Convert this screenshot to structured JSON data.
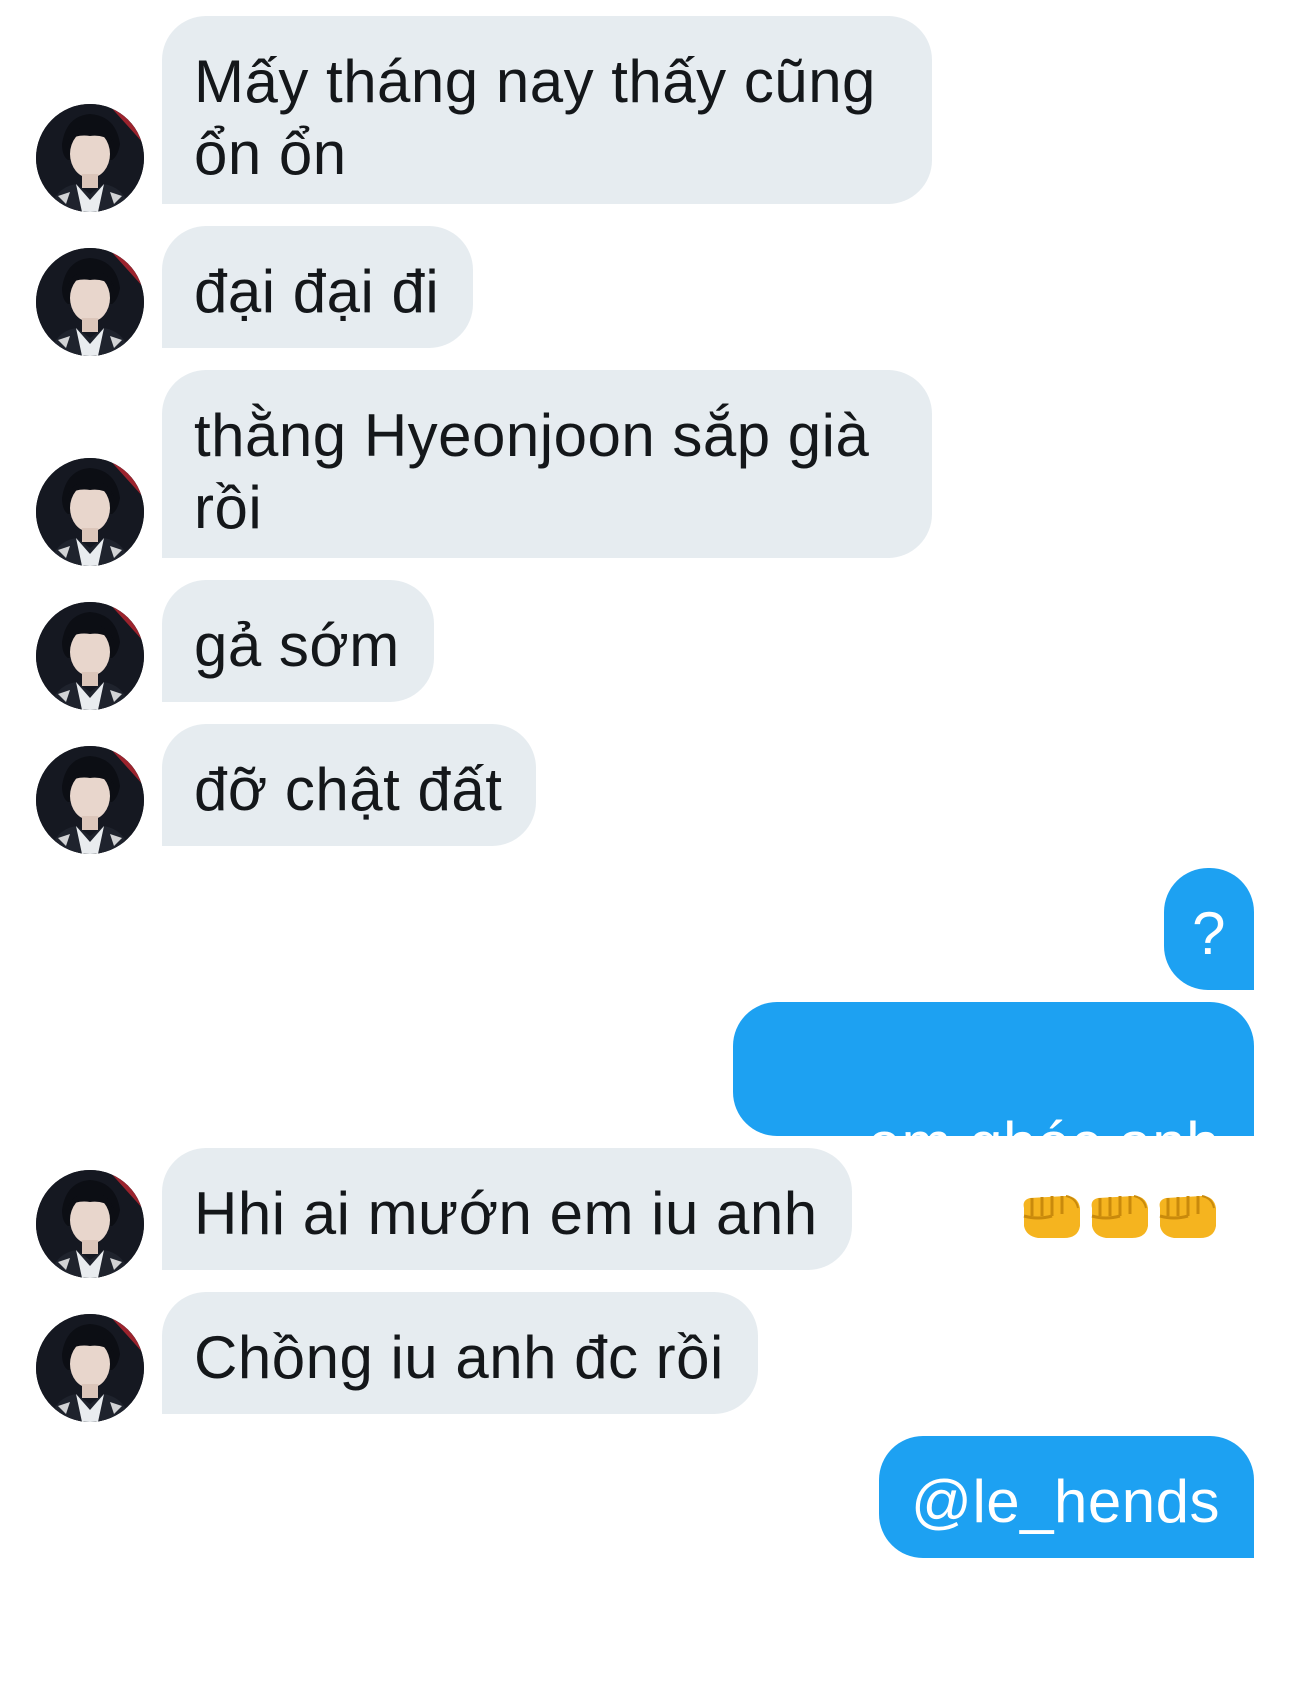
{
  "conversation": {
    "messages": [
      {
        "sender": "them",
        "text": "Mấy tháng nay thấy cũng ổn ổn"
      },
      {
        "sender": "them",
        "text": "đại đại đi"
      },
      {
        "sender": "them",
        "text": "thằng Hyeonjoon sắp già rồi"
      },
      {
        "sender": "them",
        "text": "gả sớm"
      },
      {
        "sender": "them",
        "text": "đỡ chật đất"
      },
      {
        "sender": "me",
        "text": "?"
      },
      {
        "sender": "me",
        "text": "em ghéc anh",
        "emoji": [
          "oncoming-fist-icon",
          "oncoming-fist-icon",
          "oncoming-fist-icon"
        ]
      },
      {
        "sender": "them",
        "text": "Hhi ai mướn em iu anh"
      },
      {
        "sender": "them",
        "text": "Chồng iu anh đc rồi"
      },
      {
        "sender": "me",
        "text": "@le_hends"
      }
    ]
  },
  "colors": {
    "incoming_bubble": "#e6ecf0",
    "incoming_text": "#14171a",
    "outgoing_bubble": "#1da1f2",
    "outgoing_text": "#ffffff",
    "background": "#ffffff"
  }
}
